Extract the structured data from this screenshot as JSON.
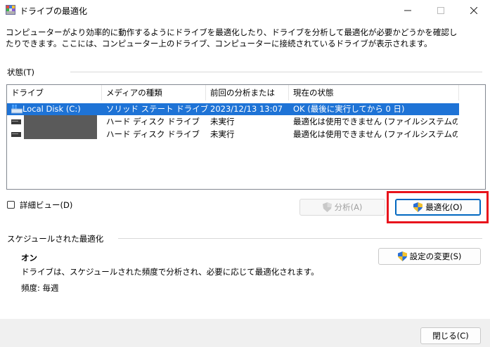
{
  "window": {
    "title": "ドライブの最適化",
    "controls": [
      "minimize",
      "maximize",
      "close"
    ]
  },
  "description": "コンピューターがより効率的に動作するようにドライブを最適化したり、ドライブを分析して最適化が必要かどうかを確認したりできます。ここには、コンピューター上のドライブ、コンピューターに接続されているドライブが表示されます。",
  "status": {
    "label": "状態(T)",
    "columns": [
      "ドライブ",
      "メディアの種類",
      "前回の分析または最...",
      "現在の状態"
    ],
    "rows": [
      {
        "drive": "Local Disk (C:)",
        "media": "ソリッド ステート ドライブ",
        "last": "2023/12/13 13:07",
        "state": "OK (最後に実行してから 0 日)",
        "selected": true,
        "drive_icon": "windows-drive-icon"
      },
      {
        "drive": "",
        "media": "ハード ディスク ドライブ",
        "last": "未実行",
        "state": "最適化は使用できません (ファイルシステムの種...",
        "selected": false,
        "drive_icon": "hard-drive-icon"
      },
      {
        "drive": "",
        "media": "ハード ディスク ドライブ",
        "last": "未実行",
        "state": "最適化は使用できません (ファイルシステムの種...",
        "selected": false,
        "drive_icon": "hard-drive-icon"
      }
    ]
  },
  "detail_view_label": "詳細ビュー(D)",
  "buttons": {
    "analyze": "分析(A)",
    "optimize": "最適化(O)",
    "change_settings": "設定の変更(S)",
    "close": "閉じる(C)"
  },
  "schedule": {
    "label": "スケジュールされた最適化",
    "state": "オン",
    "description": "ドライブは、スケジュールされた頻度で分析され、必要に応じて最適化されます。",
    "frequency": "頻度: 毎週"
  },
  "colors": {
    "selection": "#1e73d6",
    "highlight_box": "#e8141c",
    "primary_border": "#0067c0"
  }
}
